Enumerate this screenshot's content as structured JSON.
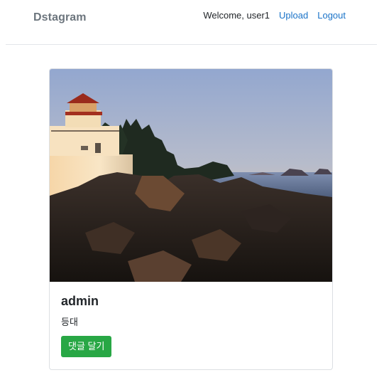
{
  "navbar": {
    "brand": "Dstagram",
    "welcome": "Welcome, user1",
    "upload_label": "Upload",
    "logout_label": "Logout"
  },
  "post": {
    "author": "admin",
    "caption": "등대",
    "comment_button_label": "댓글 달기"
  },
  "colors": {
    "brand_text": "#6c757d",
    "link": "#1a73c8",
    "button_bg": "#28a745"
  }
}
